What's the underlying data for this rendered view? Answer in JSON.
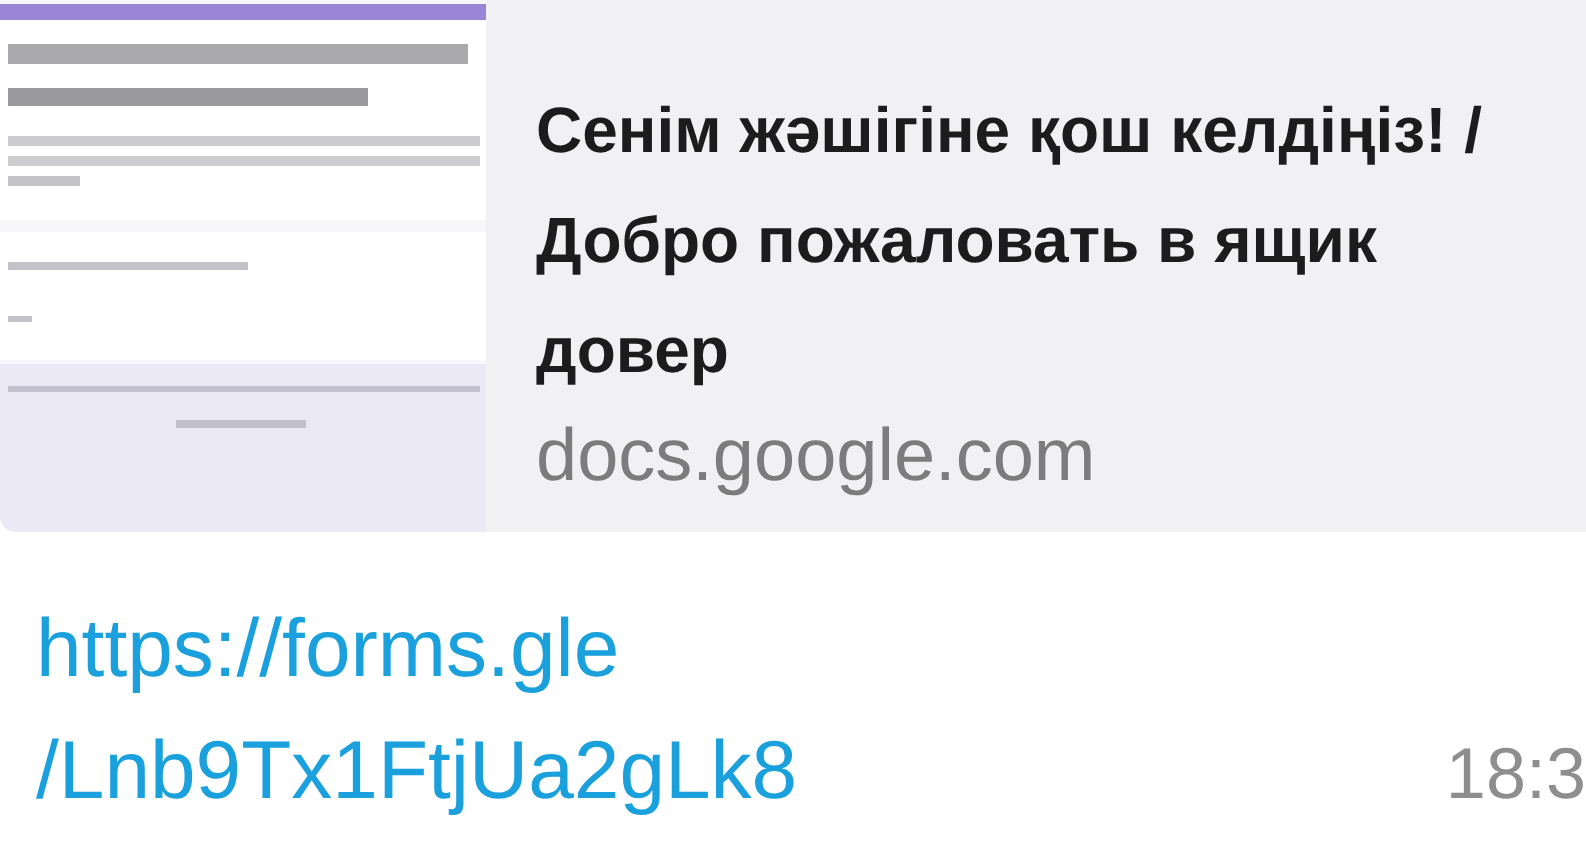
{
  "preview": {
    "title": "Сенім жәшігіне қош келдіңіз! / Добро пожаловать в ящик довер",
    "domain": "docs.google.com"
  },
  "link": {
    "lines": [
      "https://forms.gle",
      "/Lnb9Tx1FtjUa2gLk8"
    ]
  },
  "time": "18:3"
}
